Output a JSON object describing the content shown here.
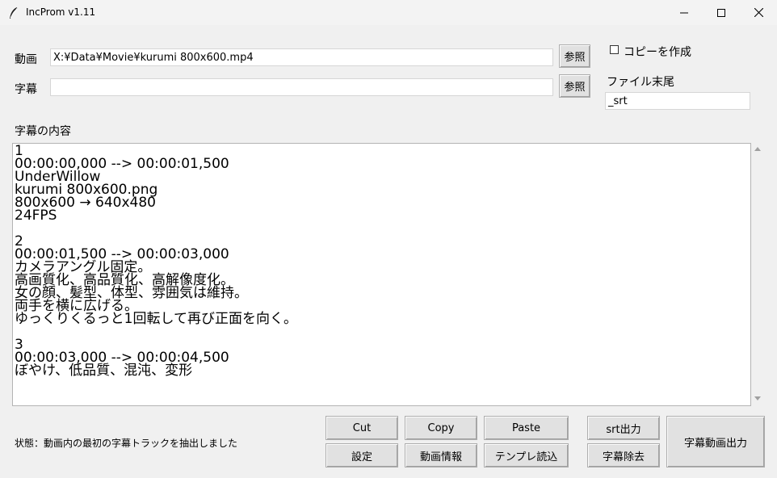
{
  "window": {
    "title": "IncProm v1.11"
  },
  "form": {
    "video_label": "動画",
    "video_path": "X:¥Data¥Movie¥kurumi 800x600.mp4",
    "video_browse": "参照",
    "subtitle_label": "字幕",
    "subtitle_path": "",
    "subtitle_browse": "参照",
    "copy_checkbox_label": "コピーを作成",
    "copy_checked": false,
    "suffix_label": "ファイル末尾",
    "suffix_value": "_srt"
  },
  "content": {
    "label": "字幕の内容",
    "lines": [
      "1",
      "00:00:00,000 --> 00:00:01,500",
      "UnderWillow",
      "kurumi 800x600.png",
      "800x600 → 640x480",
      "24FPS",
      "",
      "2",
      "00:00:01,500 --> 00:00:03,000",
      "カメラアングル固定。",
      "高画質化、高品質化、高解像度化。",
      "女の顔、髪型、体型、雰囲気は維持。",
      "両手を横に広げる。",
      "ゆっくりくるっと1回転して再び正面を向く。",
      "",
      "3",
      "00:00:03,000 --> 00:00:04,500",
      "ぼやけ、低品質、混沌、変形"
    ]
  },
  "status": {
    "text": "状態：動画内の最初の字幕トラックを抽出しました"
  },
  "buttons": {
    "cut": "Cut",
    "copy": "Copy",
    "paste": "Paste",
    "srt_output": "srt出力",
    "settings": "設定",
    "video_info": "動画情報",
    "template_load": "テンプレ読込",
    "remove_subtitle": "字幕除去",
    "subtitle_video_output": "字幕動画出力"
  }
}
